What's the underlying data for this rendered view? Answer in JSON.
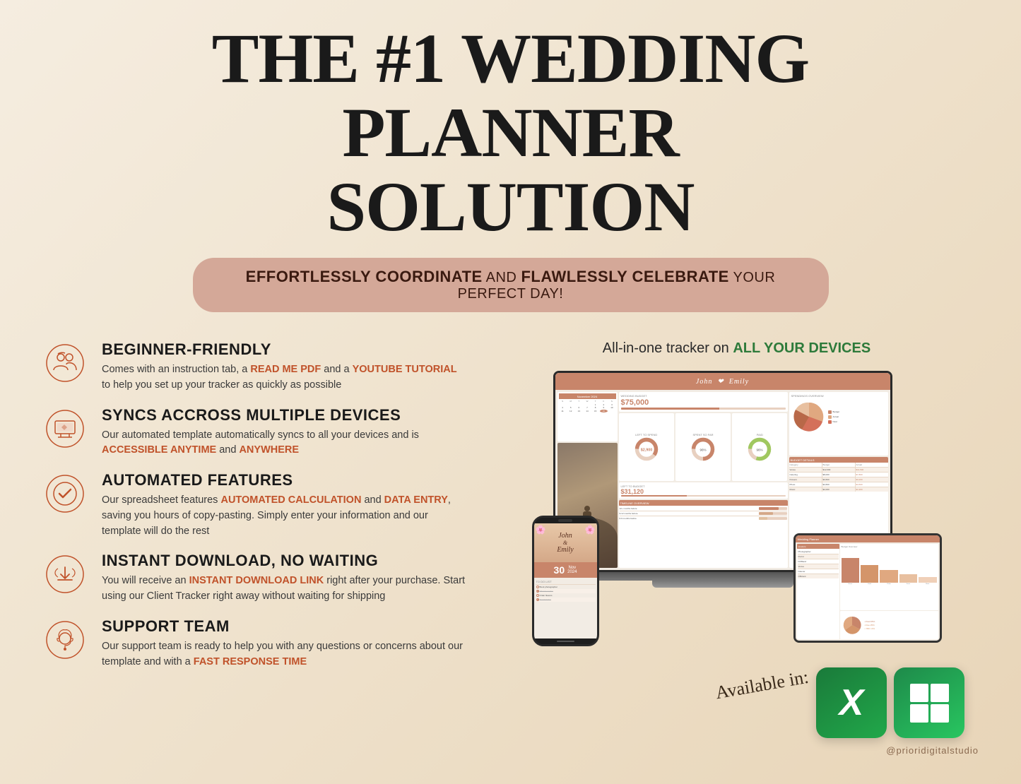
{
  "page": {
    "title_line1": "THE #1 WEDDING PLANNER",
    "title_line2": "SOLUTION",
    "subtitle_part1": "EFFORTLESSLY COORDINATE",
    "subtitle_part2": " AND ",
    "subtitle_part3": "FLAWLESSLY CELEBRATE",
    "subtitle_part4": " YOUR PERFECT DAY!",
    "devices_title_part1": "All-in-one tracker on ",
    "devices_title_part2": "ALL YOUR DEVICES",
    "available_label": "Available in:",
    "footer": "@prioridigitalstudio"
  },
  "features": [
    {
      "id": "beginner-friendly",
      "title": "BEGINNER-FRIENDLY",
      "desc_part1": "Comes with an instruction tab, a ",
      "desc_highlight1": "READ ME PDF",
      "desc_part2": " and a ",
      "desc_highlight2": "YOUTUBE TUTORIAL",
      "desc_part3": " to help you set up your tracker as quickly as possible",
      "icon": "people-icon"
    },
    {
      "id": "syncs-devices",
      "title": "SYNCS ACCROSS MULTIPLE DEVICES",
      "desc_part1": "Our automated template automatically syncs to all your devices and is ",
      "desc_highlight1": "ACCESSIBLE ANYTIME",
      "desc_part2": " and ",
      "desc_highlight2": "ANYWHERE",
      "desc_part3": "",
      "icon": "monitor-icon"
    },
    {
      "id": "automated-features",
      "title": "AUTOMATED FEATURES",
      "desc_part1": "Our spreadsheet features ",
      "desc_highlight1": "AUTOMATED CALCULATION",
      "desc_part2": " and ",
      "desc_highlight2": "DATA ENTRY",
      "desc_part3": ", saving you hours of copy-pasting. Simply enter your information and our template will do the rest",
      "icon": "checkmark-icon"
    },
    {
      "id": "instant-download",
      "title": "INSTANT DOWNLOAD, NO WAITING",
      "desc_part1": "You will receive an ",
      "desc_highlight1": "INSTANT DOWNLOAD LINK",
      "desc_part2": " right after your purchase. Start using our Client Tracker right away without waiting for shipping",
      "desc_part3": "",
      "icon": "download-icon"
    },
    {
      "id": "support-team",
      "title": "SUPPORT TEAM",
      "desc_part1": "Our support team is ready to help you with any questions or concerns about our template and with a ",
      "desc_highlight1": "FAST RESPONSE TIME",
      "desc_part2": "",
      "desc_part3": "",
      "icon": "support-icon"
    }
  ],
  "colors": {
    "orange_highlight": "#c0522a",
    "green_highlight": "#2d7a3a",
    "banner_bg": "#d4a898",
    "icon_stroke": "#c0522a"
  }
}
